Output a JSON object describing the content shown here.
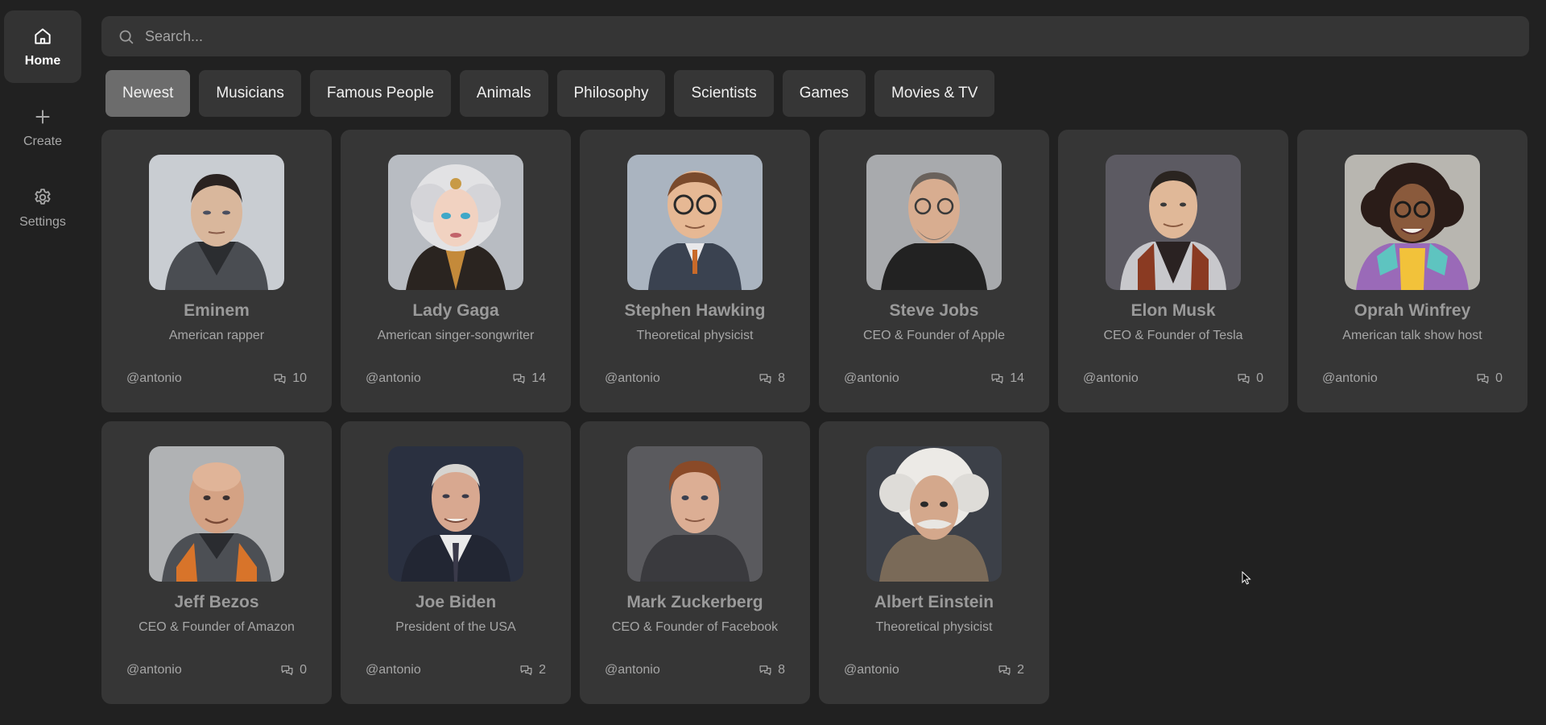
{
  "sidebar": {
    "items": [
      {
        "label": "Home",
        "icon": "home-icon",
        "active": true
      },
      {
        "label": "Create",
        "icon": "plus-icon",
        "active": false
      },
      {
        "label": "Settings",
        "icon": "gear-icon",
        "active": false
      }
    ]
  },
  "search": {
    "placeholder": "Search..."
  },
  "categories": [
    {
      "label": "Newest",
      "active": true
    },
    {
      "label": "Musicians"
    },
    {
      "label": "Famous People"
    },
    {
      "label": "Animals"
    },
    {
      "label": "Philosophy"
    },
    {
      "label": "Scientists"
    },
    {
      "label": "Games"
    },
    {
      "label": "Movies & TV"
    }
  ],
  "companions": [
    {
      "name": "Eminem",
      "description": "American rapper",
      "author": "@antonio",
      "messages": "10"
    },
    {
      "name": "Lady Gaga",
      "description": "American singer-songwriter",
      "author": "@antonio",
      "messages": "14"
    },
    {
      "name": "Stephen Hawking",
      "description": "Theoretical physicist",
      "author": "@antonio",
      "messages": "8"
    },
    {
      "name": "Steve Jobs",
      "description": "CEO & Founder of Apple",
      "author": "@antonio",
      "messages": "14"
    },
    {
      "name": "Elon Musk",
      "description": "CEO & Founder of Tesla",
      "author": "@antonio",
      "messages": "0"
    },
    {
      "name": "Oprah Winfrey",
      "description": "American talk show host",
      "author": "@antonio",
      "messages": "0"
    },
    {
      "name": "Jeff Bezos",
      "description": "CEO & Founder of Amazon",
      "author": "@antonio",
      "messages": "0"
    },
    {
      "name": "Joe Biden",
      "description": "President of the USA",
      "author": "@antonio",
      "messages": "2"
    },
    {
      "name": "Mark Zuckerberg",
      "description": "CEO & Founder of Facebook",
      "author": "@antonio",
      "messages": "8"
    },
    {
      "name": "Albert Einstein",
      "description": "Theoretical physicist",
      "author": "@antonio",
      "messages": "2"
    }
  ],
  "colors": {
    "background": "#212121",
    "card": "#363636",
    "active_category": "#6c6c6c"
  }
}
